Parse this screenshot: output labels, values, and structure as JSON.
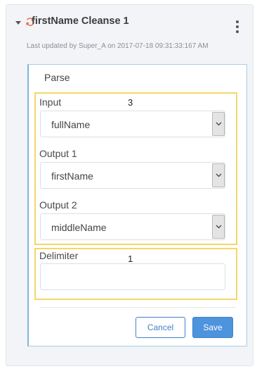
{
  "header": {
    "title": "firstName Cleanse 1",
    "last_updated": "Last updated by Super_A on 2017-07-18 09:31:33:167 AM"
  },
  "icons": {
    "collapse": "caret-down-icon",
    "refresh": "refresh-icon",
    "menu": "kebab-menu-icon",
    "select_arrow": "chevron-down-icon"
  },
  "colors": {
    "refresh_icon": "#e8693a",
    "highlight_border": "#f3d867",
    "card_border": "#a9cdea",
    "primary_button": "#4e93dd"
  },
  "card": {
    "title": "Parse"
  },
  "highlights": {
    "group_a_number": "3",
    "group_b_number": "1"
  },
  "fields": {
    "input": {
      "label": "Input",
      "value": "fullName"
    },
    "output1": {
      "label": "Output 1",
      "value": "firstName"
    },
    "output2": {
      "label": "Output 2",
      "value": "middleName"
    },
    "delimiter": {
      "label": "Delimiter",
      "value": "",
      "placeholder": ""
    }
  },
  "actions": {
    "cancel_label": "Cancel",
    "save_label": "Save"
  }
}
